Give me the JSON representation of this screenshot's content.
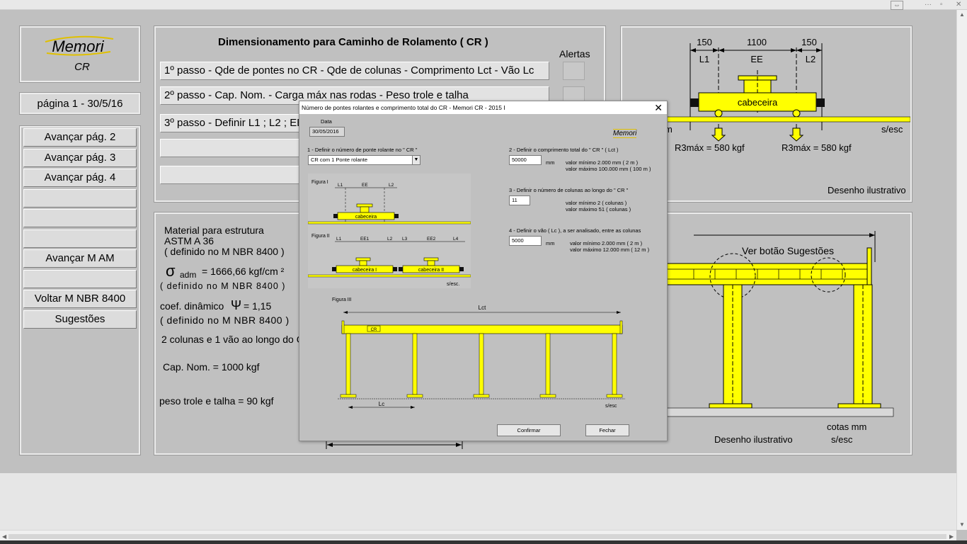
{
  "logo": {
    "title": "Memori",
    "subtitle": "CR"
  },
  "page_info": "página 1 -   30/5/16",
  "nav_buttons": [
    "Avançar pág. 2",
    "Avançar pág. 3",
    "Avançar pág. 4",
    "",
    "",
    "",
    "Avançar M AM",
    "",
    "Voltar M  NBR  8400",
    "Sugestões"
  ],
  "main": {
    "heading": "Dimensionamento para Caminho de Rolamento ( CR )",
    "alerts_label": "Alertas",
    "steps": [
      "1º passo - Qde de pontes no CR - Qde de colunas - Comprimento Lct - Vão Lc",
      "2º passo - Cap. Nom. - Carga máx nas rodas - Peso trole e talha",
      "3º passo - Definir L1 ; L2 ; EE",
      "",
      ""
    ]
  },
  "info_panel": {
    "material_label": "Material para estrutura",
    "material": "ASTM A 36",
    "material_ref": "( definido no M NBR 8400 )",
    "sigma_symbol": "σ",
    "sigma_sub": "adm",
    "sigma_value": "= 1666,66 kgf/cm ²",
    "sigma_ref": "( definido no M NBR 8400 )",
    "coef_label": "coef. dinâmico",
    "psi_symbol": "Ψ",
    "coef_value": "= 1,15",
    "coef_ref": "( definido no M NBR 8400 )",
    "columns_summary": "2 colunas e 1 vão ao longo do CR",
    "capacity": "Cap. Nom. = 1000 kgf",
    "trolley_weight": "peso trole e talha = 90 kgf"
  },
  "top_drawing": {
    "dims": [
      "150",
      "1100",
      "150"
    ],
    "labels": [
      "L1",
      "EE",
      "L2"
    ],
    "part": "cabeceira",
    "partial_left_label": "m",
    "scale": "s/esc",
    "reaction_left": "R3máx = 580 kgf",
    "reaction_right": "R3máx = 580 kgf",
    "caption": "Desenho ilustrativo"
  },
  "bottom_drawing": {
    "suggestion": "Ver botão Sugestões",
    "units": "cotas mm",
    "caption": "Desenho ilustrativo",
    "scale": "s/esc"
  },
  "dialog": {
    "title": "Número de pontes rolantes e comprimento total do CR - Memori  CR - 2015 I",
    "date_label": "Data",
    "date_value": "30/05/2016",
    "logo": "Memori",
    "q1_label": "1 - Definir o número de ponte rolante no \" CR \"",
    "q1_value": "CR com 1 Ponte rolante",
    "q2_label": "2 - Definir o comprimento total do \" CR \" ( Lct )",
    "q2_value": "50000",
    "q2_unit": "mm",
    "q2_min": "valor mínimo      2.000 mm   ( 2 m )",
    "q2_max": "valor máximo  100.000 mm   ( 100 m )",
    "q3_label": "3 - Definir o número de colunas ao longo do \" CR \"",
    "q3_value": "11",
    "q3_min": "valor mínimo        2  ( colunas )",
    "q3_max": "valor máximo      51  ( colunas )",
    "q4_label": "4 - Definir o vão ( Lc ), a ser analisado, entre as colunas",
    "q4_value": "5000",
    "q4_unit": "mm",
    "q4_min": "valor mínimo     2.000 mm   ( 2 m )",
    "q4_max": "valor máximo  12.000 mm   ( 12 m )",
    "fig1_label": "Figura I",
    "fig2_label": "Figura II",
    "fig3_label": "Figura III",
    "fig_l1": "L1",
    "fig_ee": "EE",
    "fig_l2": "L2",
    "fig_l3": "L3",
    "fig_ee1": "EE1",
    "fig_ee2": "EE2",
    "fig_l4": "L4",
    "fig_part": "cabeceira",
    "fig_part1": "cabeceira I",
    "fig_part2": "cabeceira II",
    "fig_scale": "s/esc.",
    "fig3_lct": "Lct",
    "fig3_cr": "CR",
    "fig3_lc": "Lc",
    "fig3_scale": "s/esc",
    "confirm": "Confirmar",
    "close": "Fechar"
  },
  "colors": {
    "steel": "#ffff00",
    "background": "#c0c0c0",
    "button": "#dcdcdc"
  }
}
